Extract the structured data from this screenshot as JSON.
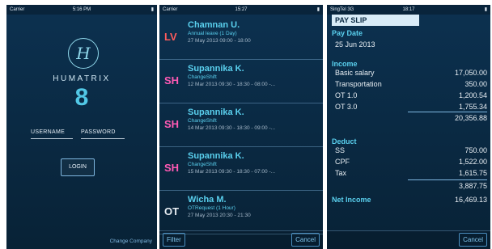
{
  "phone1": {
    "status": {
      "carrier": "Carrier",
      "time": "5:16 PM"
    },
    "logo": "H",
    "brand": "HUMATRIX",
    "version": "8",
    "username_label": "USERNAME",
    "password_label": "PASSWORD",
    "login_label": "LOGIN",
    "change_company": "Change Company"
  },
  "phone2": {
    "status": {
      "carrier": "Carrier",
      "time": "15:27"
    },
    "items": [
      {
        "code": "LV",
        "code_color": "#ff5c5c",
        "name": "Chamnan U.",
        "type": "Annual leave (1 Day)",
        "time": "27 May 2013 09:00 - 18:00"
      },
      {
        "code": "SH",
        "code_color": "#ff5ab4",
        "name": "Supannika K.",
        "type": "ChangeShift",
        "time": "12 Mar 2013 09:30 - 18:30 - 08:00 -..."
      },
      {
        "code": "SH",
        "code_color": "#ff5ab4",
        "name": "Supannika K.",
        "type": "ChangeShift",
        "time": "14 Mar 2013 09:30 - 18:30 - 09:00 -..."
      },
      {
        "code": "SH",
        "code_color": "#ff5ab4",
        "name": "Supannika K.",
        "type": "ChangeShift",
        "time": "15 Mar 2013 09:30 - 18:30 - 07:00 -..."
      },
      {
        "code": "OT",
        "code_color": "#e8eef3",
        "name": "Wicha M.",
        "type": "OTRequest (1 Hour)",
        "time": "27 May 2013 20:30 - 21:30"
      }
    ],
    "filter_label": "Filter",
    "cancel_label": "Cancel"
  },
  "phone3": {
    "status": {
      "carrier": "SingTel 3G",
      "time": "18:17",
      "right": ""
    },
    "title": "PAY SLIP",
    "pay_date_label": "Pay Date",
    "pay_date": "25 Jun 2013",
    "income_label": "Income",
    "income": [
      {
        "label": "Basic salary",
        "value": "17,050.00"
      },
      {
        "label": "Transportation",
        "value": "350.00"
      },
      {
        "label": "OT 1.0",
        "value": "1,200.54"
      },
      {
        "label": "OT 3.0",
        "value": "1,755.34"
      }
    ],
    "income_total": "20,356.88",
    "deduct_label": "Deduct",
    "deduct": [
      {
        "label": "SS",
        "value": "750.00"
      },
      {
        "label": "CPF",
        "value": "1,522.00"
      },
      {
        "label": "Tax",
        "value": "1,615.75"
      }
    ],
    "deduct_total": "3,887.75",
    "net_label": "Net Income",
    "net_value": "16,469.13",
    "cancel_label": "Cancel"
  }
}
